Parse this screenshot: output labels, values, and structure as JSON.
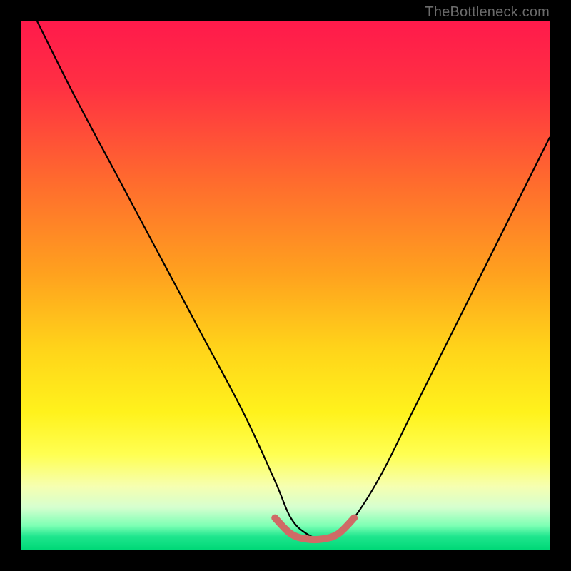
{
  "watermark": "TheBottleneck.com",
  "colors": {
    "frame": "#000000",
    "curve": "#000000",
    "flat_segment": "#cf6b66",
    "gradient_stops": [
      {
        "offset": 0.0,
        "color": "#ff1a4b"
      },
      {
        "offset": 0.12,
        "color": "#ff2f43"
      },
      {
        "offset": 0.3,
        "color": "#ff6a2e"
      },
      {
        "offset": 0.48,
        "color": "#ffa21e"
      },
      {
        "offset": 0.62,
        "color": "#ffd41a"
      },
      {
        "offset": 0.74,
        "color": "#fff21c"
      },
      {
        "offset": 0.82,
        "color": "#ffff52"
      },
      {
        "offset": 0.88,
        "color": "#f6ffb0"
      },
      {
        "offset": 0.92,
        "color": "#d6ffcf"
      },
      {
        "offset": 0.955,
        "color": "#7cffb4"
      },
      {
        "offset": 0.975,
        "color": "#1fe68e"
      },
      {
        "offset": 1.0,
        "color": "#00d877"
      }
    ]
  },
  "chart_data": {
    "type": "line",
    "title": "",
    "xlabel": "",
    "ylabel": "",
    "xlim": [
      0,
      100
    ],
    "ylim": [
      0,
      100
    ],
    "annotations": [
      "TheBottleneck.com"
    ],
    "series": [
      {
        "name": "bottleneck-curve",
        "x": [
          3,
          10,
          18,
          26,
          34,
          42,
          48,
          51,
          54,
          57,
          60,
          63,
          68,
          74,
          80,
          86,
          92,
          98,
          100
        ],
        "y": [
          100,
          86,
          71,
          56,
          41,
          26,
          13,
          6,
          3,
          2,
          3,
          6,
          14,
          26,
          38,
          50,
          62,
          74,
          78
        ]
      },
      {
        "name": "flat-bottom-highlight",
        "x": [
          48,
          51,
          54,
          57,
          60,
          63
        ],
        "y": [
          6,
          3,
          2,
          2,
          3,
          6
        ]
      }
    ]
  }
}
